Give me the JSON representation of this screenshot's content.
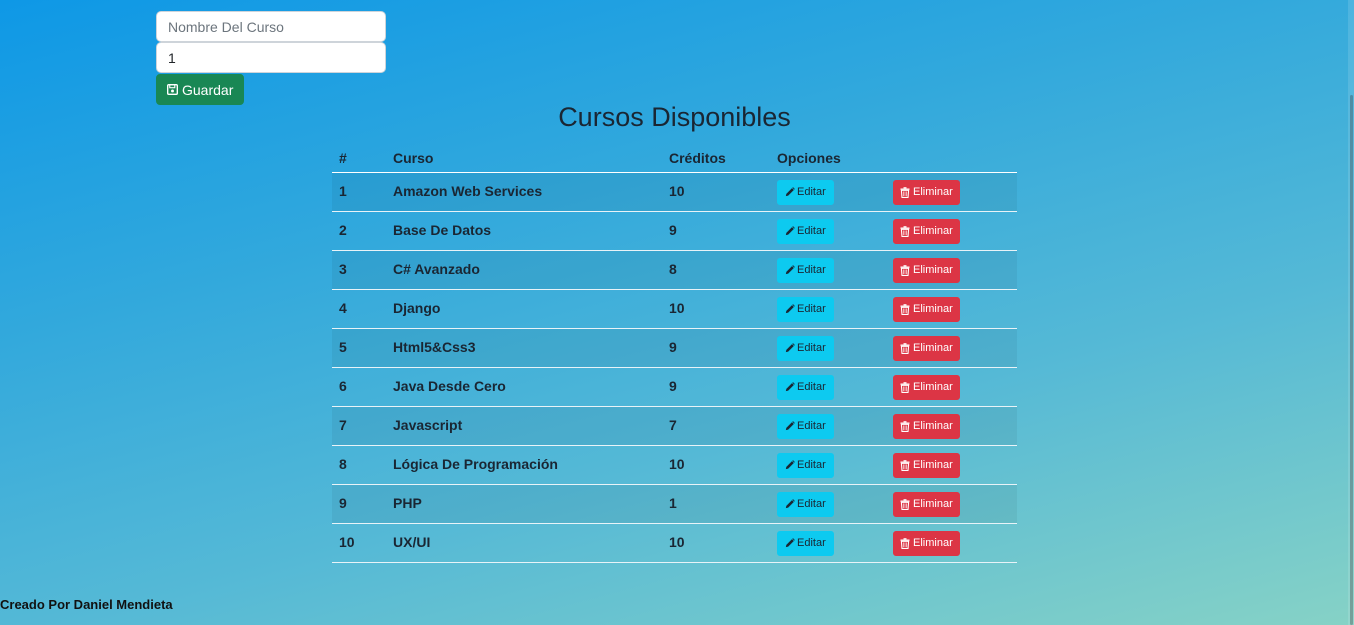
{
  "form": {
    "name_placeholder": "Nombre Del Curso",
    "name_value": "",
    "credits_value": "1",
    "save_label": "Guardar",
    "save_icon": "floppy-disk-icon"
  },
  "page_title": "Cursos Disponibles",
  "table": {
    "headers": [
      "#",
      "Curso",
      "Créditos",
      "Opciones",
      ""
    ],
    "edit_label": "Editar",
    "edit_icon": "pencil-icon",
    "delete_label": "Eliminar",
    "delete_icon": "trash-icon",
    "rows": [
      {
        "num": "1",
        "curso": "Amazon Web Services",
        "creditos": "10"
      },
      {
        "num": "2",
        "curso": "Base De Datos",
        "creditos": "9"
      },
      {
        "num": "3",
        "curso": "C# Avanzado",
        "creditos": "8"
      },
      {
        "num": "4",
        "curso": "Django",
        "creditos": "10"
      },
      {
        "num": "5",
        "curso": "Html5&Css3",
        "creditos": "9"
      },
      {
        "num": "6",
        "curso": "Java Desde Cero",
        "creditos": "9"
      },
      {
        "num": "7",
        "curso": "Javascript",
        "creditos": "7"
      },
      {
        "num": "8",
        "curso": "Lógica De Programación",
        "creditos": "10"
      },
      {
        "num": "9",
        "curso": "PHP",
        "creditos": "1"
      },
      {
        "num": "10",
        "curso": "UX/UI",
        "creditos": "10"
      }
    ]
  },
  "footer": "Creado Por Daniel Mendieta",
  "colors": {
    "save_button": "#198754",
    "edit_button": "#0dcaf0",
    "delete_button": "#dc3545",
    "gradient_start": "#0e98e6",
    "gradient_end": "#86d2c6"
  }
}
